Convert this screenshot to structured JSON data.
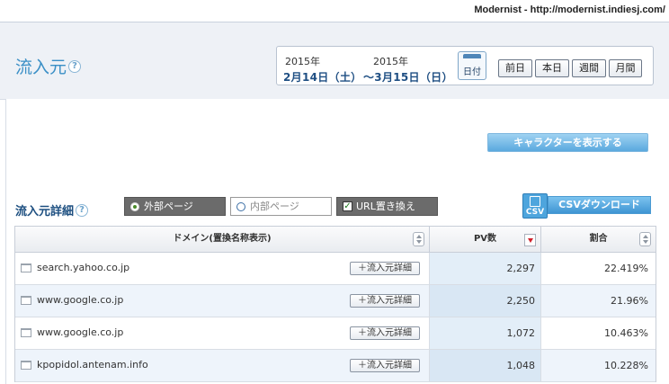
{
  "site_caption": "Modernist - http://modernist.indiesj.com/",
  "page": {
    "title": "流入元",
    "help": "?"
  },
  "date_range": {
    "start_year": "2015年",
    "start_date": "2月14日（土）",
    "end_year": "2015年",
    "end_date": "～3月15日（日）",
    "calendar_label": "日付"
  },
  "period_buttons": [
    "前日",
    "本日",
    "週間",
    "月間"
  ],
  "character_button": "キャラクターを表示する",
  "section": {
    "title": "流入元詳細",
    "help": "?"
  },
  "filters": {
    "external": "外部ページ",
    "internal": "内部ページ",
    "url_replace": "URL置き換え",
    "url_replace_checked": "✓"
  },
  "csv_button": {
    "icon_text": "CSV",
    "label": "CSVダウンロード"
  },
  "table": {
    "headers": {
      "domain": "ドメイン(置換名称表示)",
      "pv": "PV数",
      "ratio": "割合"
    },
    "detail_label": "＋流入元詳細",
    "rows": [
      {
        "domain": "search.yahoo.co.jp",
        "pv": "2,297",
        "ratio": "22.419%"
      },
      {
        "domain": "www.google.co.jp",
        "pv": "2,250",
        "ratio": "21.96%"
      },
      {
        "domain": "www.google.co.jp",
        "pv": "1,072",
        "ratio": "10.463%"
      },
      {
        "domain": "kpopidol.antenam.info",
        "pv": "1,048",
        "ratio": "10.228%"
      }
    ]
  },
  "colors": {
    "accent": "#3a8fc6",
    "title_dark": "#1d4f80",
    "button_blue": "#5aa9de",
    "sort_active": "#d0202a"
  }
}
